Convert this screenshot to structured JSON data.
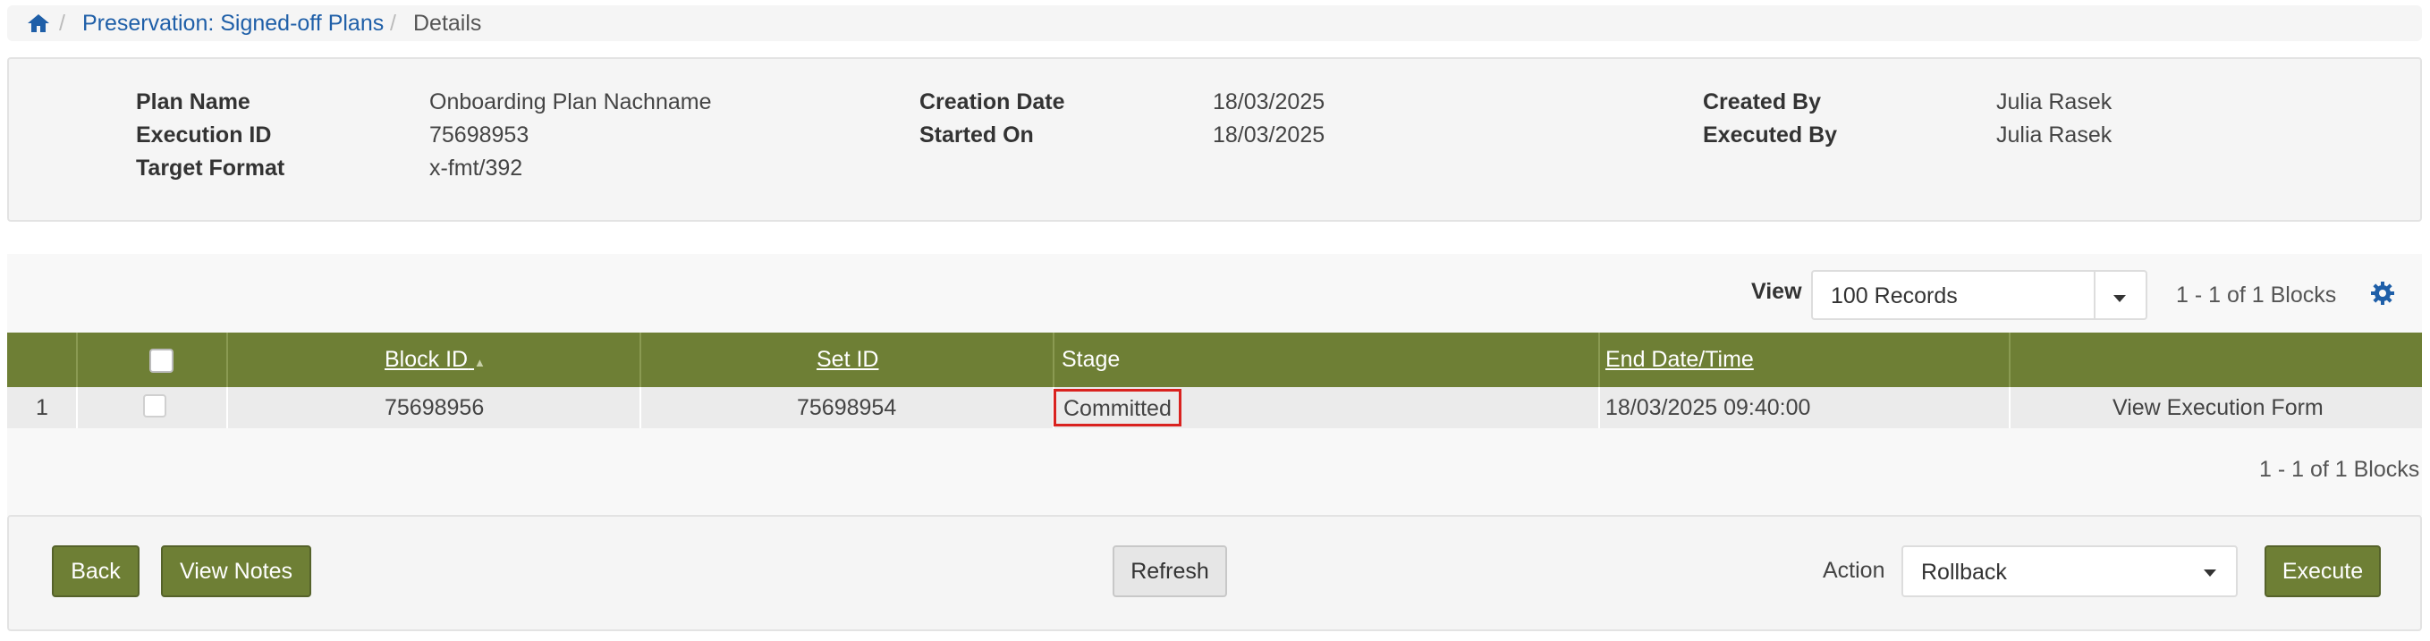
{
  "breadcrumb": {
    "home_icon": "home-icon",
    "items": [
      {
        "label": "Preservation: Signed-off Plans"
      },
      {
        "label": "Details"
      }
    ],
    "separator": "/"
  },
  "details": {
    "plan_name": {
      "label": "Plan Name",
      "value": "Onboarding Plan Nachname"
    },
    "execution_id": {
      "label": "Execution ID",
      "value": "75698953"
    },
    "target_format": {
      "label": "Target Format",
      "value": "x-fmt/392"
    },
    "creation_date": {
      "label": "Creation Date",
      "value": "18/03/2025"
    },
    "started_on": {
      "label": "Started On",
      "value": "18/03/2025"
    },
    "created_by": {
      "label": "Created By",
      "value": "Julia Rasek"
    },
    "executed_by": {
      "label": "Executed By",
      "value": "Julia Rasek"
    }
  },
  "toolbar": {
    "view_label": "View",
    "view_value": "100 Records",
    "pagination_top": "1 - 1 of 1 Blocks",
    "settings_icon": "gear-icon"
  },
  "table": {
    "headers": {
      "block_id": "Block ID",
      "set_id": "Set ID",
      "stage": "Stage",
      "end_datetime": "End Date/Time"
    },
    "sort_indicator": "▲",
    "rows": [
      {
        "index": "1",
        "block_id": "75698956",
        "set_id": "75698954",
        "stage": "Committed",
        "end_datetime": "18/03/2025 09:40:00",
        "action": "View Execution Form"
      }
    ],
    "pagination_bottom": "1 - 1 of 1 Blocks"
  },
  "footer": {
    "back_label": "Back",
    "view_notes_label": "View Notes",
    "refresh_label": "Refresh",
    "action_label": "Action",
    "action_value": "Rollback",
    "execute_label": "Execute"
  },
  "colors": {
    "header_green": "#6e7f35",
    "link_blue": "#1f5fa8",
    "highlight_red": "#d9221f"
  }
}
